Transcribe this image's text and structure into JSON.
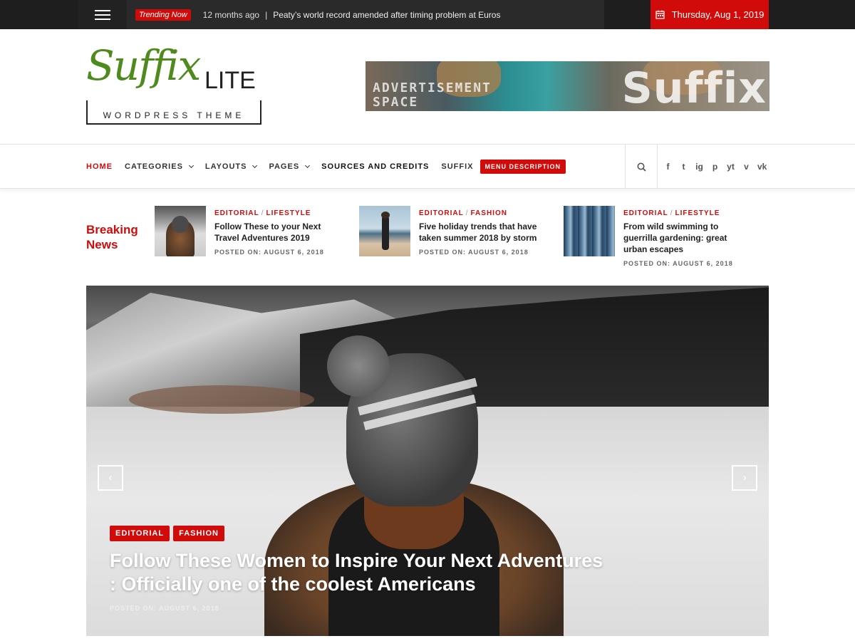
{
  "topbar": {
    "trending_label": "Trending Now",
    "trending_time": "12 months ago",
    "trending_sep": "|",
    "trending_headline": "Peaty’s world record amended after timing problem at Euros",
    "date": "Thursday, Aug 1, 2019"
  },
  "logo": {
    "script": "Suffix",
    "lite": "LITE",
    "subtitle": "WORDPRESS THEME"
  },
  "ad": {
    "line1": "ADVERTISEMENT",
    "line2": "SPACE",
    "brand": "Suffix"
  },
  "nav": {
    "items": [
      {
        "label": "HOME"
      },
      {
        "label": "CATEGORIES"
      },
      {
        "label": "LAYOUTS"
      },
      {
        "label": "PAGES"
      },
      {
        "label": "SOURCES AND CREDITS"
      },
      {
        "label": "SUFFIX"
      }
    ],
    "menu_description": "MENU DESCRIPTION",
    "social": [
      "f",
      "t",
      "ig",
      "p",
      "yt",
      "v",
      "vk"
    ]
  },
  "breaking": {
    "title_line1": "Breaking",
    "title_line2": "News",
    "items": [
      {
        "cat1": "EDITORIAL",
        "cat2": "LIFESTYLE",
        "title": "Follow These to your Next Travel Adventures 2019",
        "date": "POSTED ON: AUGUST 6, 2018"
      },
      {
        "cat1": "EDITORIAL",
        "cat2": "FASHION",
        "title": "Five holiday trends that have taken summer 2018 by storm",
        "date": "POSTED ON: AUGUST 6, 2018"
      },
      {
        "cat1": "EDITORIAL",
        "cat2": "LIFESTYLE",
        "title": "From wild swimming to guerrilla gardening: great urban escapes",
        "date": "POSTED ON: AUGUST 6, 2018"
      }
    ]
  },
  "hero": {
    "tags": [
      "EDITORIAL",
      "FASHION"
    ],
    "title": "Follow These Women to Inspire Your Next Adventures : Officially one of the coolest Americans",
    "date": "POSTED ON: AUGUST 6, 2018",
    "prev": "‹",
    "next": "›"
  },
  "colors": {
    "accent": "#d10a0a",
    "logo_green": "#4f8a1d",
    "topbar": "#1e1e1e"
  }
}
